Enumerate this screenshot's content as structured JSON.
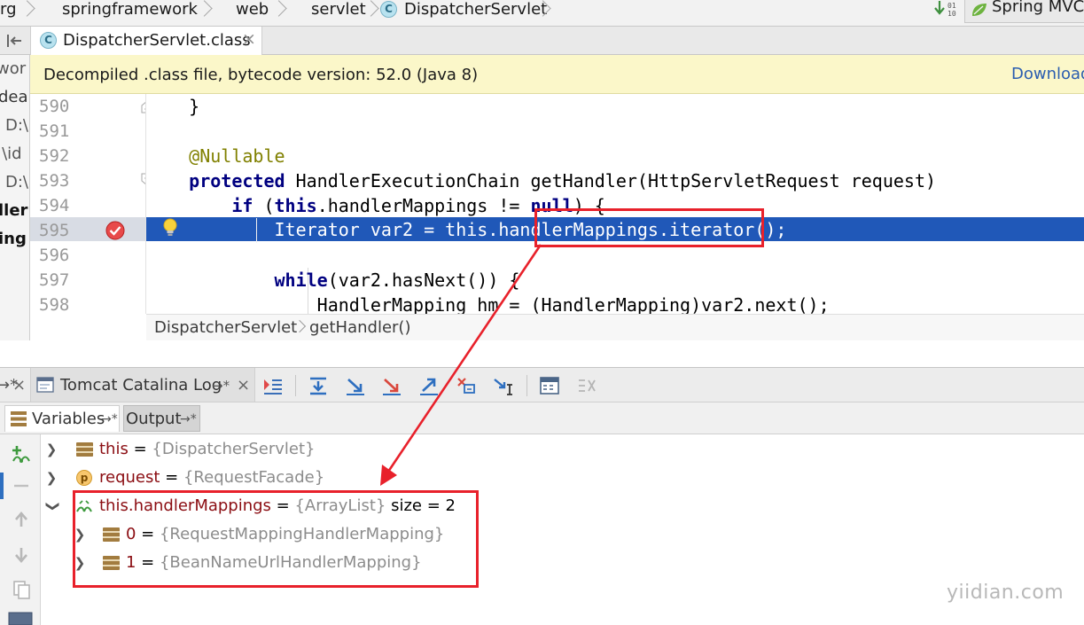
{
  "breadcrumb": {
    "items": [
      "rg",
      "springframework",
      "web",
      "servlet",
      "DispatcherServlet"
    ],
    "run_config": "Spring MVC"
  },
  "editor_tab": {
    "label": "DispatcherServlet.class",
    "close": "×"
  },
  "left_panel": {
    "texts": [
      "wor",
      "dea",
      "D:\\",
      ":\\id",
      "D:\\",
      "ller",
      "ing"
    ]
  },
  "banner": {
    "message": "Decompiled .class file, bytecode version: 52.0 (Java 8)",
    "action": "Download"
  },
  "code": {
    "lines": [
      {
        "no": "590",
        "parts": [
          {
            "t": "    }",
            "c": ""
          }
        ]
      },
      {
        "no": "591",
        "parts": []
      },
      {
        "no": "592",
        "parts": [
          {
            "t": "    ",
            "c": ""
          },
          {
            "t": "@Nullable",
            "c": "ann"
          }
        ]
      },
      {
        "no": "593",
        "parts": [
          {
            "t": "    ",
            "c": ""
          },
          {
            "t": "protected",
            "c": "kw"
          },
          {
            "t": " HandlerExecutionChain getHandler(HttpServletRequest request)",
            "c": ""
          }
        ]
      },
      {
        "no": "594",
        "parts": [
          {
            "t": "        ",
            "c": ""
          },
          {
            "t": "if",
            "c": "kw"
          },
          {
            "t": " (",
            "c": ""
          },
          {
            "t": "this",
            "c": "kw"
          },
          {
            "t": ".handlerMappings != ",
            "c": ""
          },
          {
            "t": "null",
            "c": "kw"
          },
          {
            "t": ") {",
            "c": ""
          }
        ]
      },
      {
        "no": "595",
        "parts": [
          {
            "t": "            Iterator var2 = this.handlerMappings.iterator();",
            "c": ""
          }
        ],
        "current": true
      },
      {
        "no": "596",
        "parts": []
      },
      {
        "no": "597",
        "parts": [
          {
            "t": "            ",
            "c": ""
          },
          {
            "t": "while",
            "c": "kw"
          },
          {
            "t": "(var2.hasNext()) {",
            "c": ""
          }
        ]
      },
      {
        "no": "598",
        "parts": [
          {
            "t": "                HandlerMapping hm = (HandlerMapping)var2.next();",
            "c": ""
          }
        ]
      }
    ]
  },
  "editor_breadcrumb": {
    "class_name": "DispatcherServlet",
    "method_name": "getHandler()"
  },
  "debug": {
    "tab_label": "Tomcat Catalina Log",
    "tab_pin": "→*",
    "close": "×",
    "subtabs": {
      "variables": "Variables",
      "output": "Output",
      "pin": "→*"
    },
    "variables": [
      {
        "name": "this",
        "type": "{DispatcherServlet}",
        "extra": "",
        "icon": "field-icon",
        "indent": 0,
        "expanded": false
      },
      {
        "name": "request",
        "type": "{RequestFacade}",
        "extra": "",
        "icon": "parameter-icon",
        "icon_letter": "p",
        "indent": 0,
        "expanded": false
      },
      {
        "name": "this.handlerMappings",
        "type": "{ArrayList}",
        "extra": "size = 2",
        "icon": "watch-icon",
        "indent": 0,
        "expanded": true
      },
      {
        "name": "0",
        "type": "{RequestMappingHandlerMapping}",
        "extra": "",
        "icon": "field-icon",
        "indent": 1,
        "expanded": false
      },
      {
        "name": "1",
        "type": "{BeanNameUrlHandlerMapping}",
        "extra": "",
        "icon": "field-icon",
        "indent": 1,
        "expanded": false
      }
    ]
  },
  "watermark": "yiidian.com",
  "colors": {
    "execution_line": "#2058b8",
    "banner": "#fbf7c9",
    "annotation_red": "#e8212b",
    "keyword": "#000080",
    "variable_name": "#8b0d12"
  }
}
